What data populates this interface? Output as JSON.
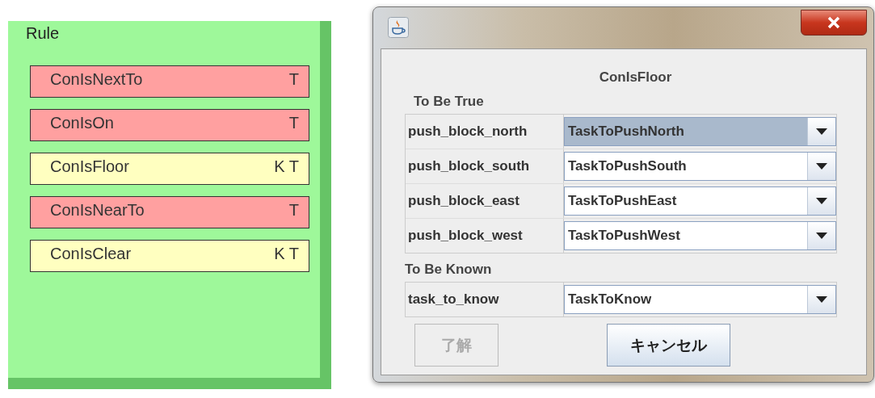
{
  "rule_panel": {
    "title": "Rule",
    "conditions": [
      {
        "name": "ConIsNextTo",
        "flags": "T",
        "color": "#ffa0a0"
      },
      {
        "name": "ConIsOn",
        "flags": "T",
        "color": "#ffa0a0"
      },
      {
        "name": "ConIsFloor",
        "flags": "K T",
        "color": "#ffffc0"
      },
      {
        "name": "ConIsNearTo",
        "flags": "T",
        "color": "#ffa0a0"
      },
      {
        "name": "ConIsClear",
        "flags": "K T",
        "color": "#ffffc0"
      }
    ]
  },
  "dialog": {
    "title": "ConIsFloor",
    "sections": [
      {
        "heading": "To Be True",
        "rows": [
          {
            "label": "push_block_north",
            "value": "TaskToPushNorth",
            "selected": true
          },
          {
            "label": "push_block_south",
            "value": "TaskToPushSouth",
            "selected": false
          },
          {
            "label": "push_block_east",
            "value": "TaskToPushEast",
            "selected": false
          },
          {
            "label": "push_block_west",
            "value": "TaskToPushWest",
            "selected": false
          }
        ]
      },
      {
        "heading": "To Be Known",
        "rows": [
          {
            "label": "task_to_know",
            "value": "TaskToKnow",
            "selected": false
          }
        ]
      }
    ],
    "buttons": [
      {
        "label": "了解",
        "disabled": true
      },
      {
        "label": "キャンセル",
        "disabled": false
      }
    ]
  }
}
